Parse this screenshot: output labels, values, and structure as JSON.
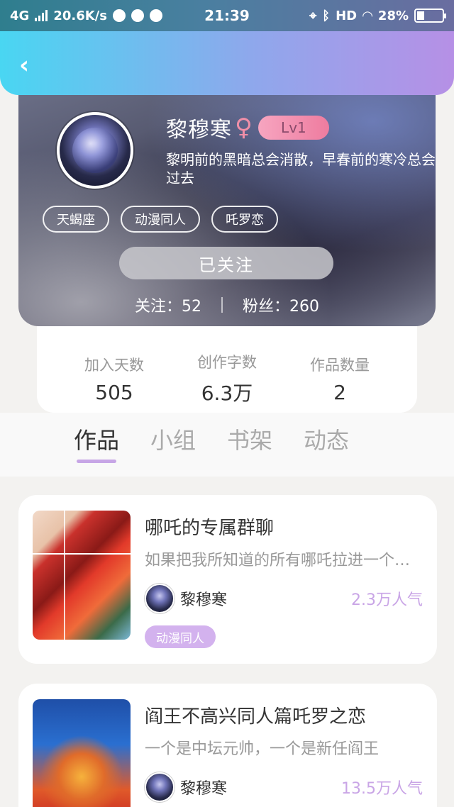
{
  "status_bar": {
    "network": "4G",
    "speed": "20.6K/s",
    "time": "21:39",
    "hd": "HD",
    "battery": "28%",
    "battery_level": 0.28
  },
  "header": {
    "back_icon": "chevron-left-icon"
  },
  "profile": {
    "name": "黎穆寒",
    "gender_symbol": "♀",
    "level": "Lv1",
    "bio": "黎明前的黑暗总会消散，早春前的寒冷总会过去",
    "tags": [
      "天蝎座",
      "动漫同人",
      "吒罗恋"
    ],
    "follow_button": "已关注",
    "following_label": "关注：52",
    "followers_label": "粉丝：260"
  },
  "stats": [
    {
      "label": "加入天数",
      "value": "505"
    },
    {
      "label": "创作字数",
      "value": "6.3万"
    },
    {
      "label": "作品数量",
      "value": "2"
    }
  ],
  "tabs": [
    {
      "label": "作品",
      "active": true
    },
    {
      "label": "小组",
      "active": false
    },
    {
      "label": "书架",
      "active": false
    },
    {
      "label": "动态",
      "active": false
    }
  ],
  "works": [
    {
      "title": "哪吒的专属群聊",
      "description": "如果把我所知道的所有哪吒拉进一个群里会怎样",
      "author": "黎穆寒",
      "popularity": "2.3万人气",
      "genre": "动漫同人"
    },
    {
      "title": "阎王不高兴同人篇吒罗之恋",
      "description": "一个是中坛元帅，一个是新任阎王",
      "author": "黎穆寒",
      "popularity": "13.5万人气"
    }
  ],
  "colors": {
    "accent": "#c7a6e6",
    "header_start": "#49d6f2",
    "header_end": "#b690e6",
    "level_badge": "#ee7c9f"
  }
}
